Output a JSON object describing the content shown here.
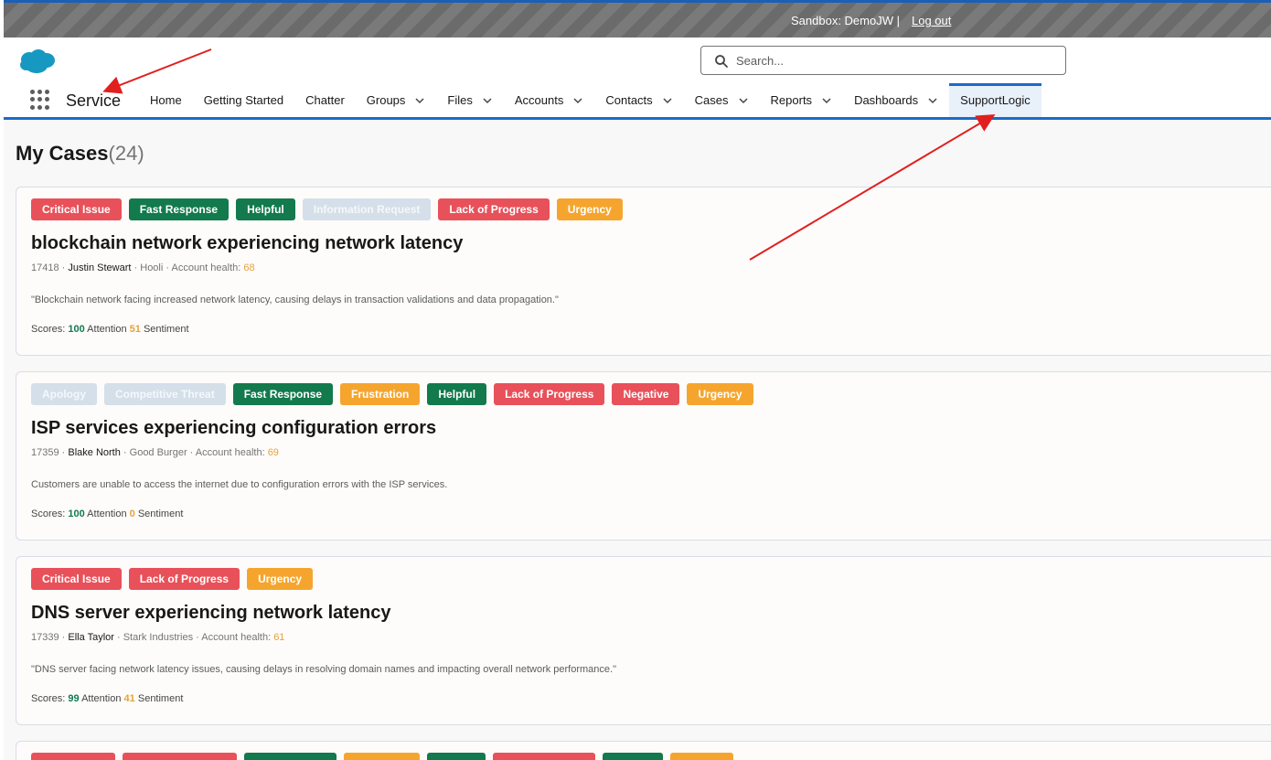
{
  "sandbox": {
    "label": "Sandbox: DemoJW |",
    "logout": "Log out"
  },
  "search": {
    "placeholder": "Search..."
  },
  "app": {
    "name": "Service"
  },
  "nav": [
    {
      "label": "Home"
    },
    {
      "label": "Getting Started"
    },
    {
      "label": "Chatter"
    },
    {
      "label": "Groups"
    },
    {
      "label": "Files"
    },
    {
      "label": "Accounts"
    },
    {
      "label": "Contacts"
    },
    {
      "label": "Cases"
    },
    {
      "label": "Reports"
    },
    {
      "label": "Dashboards"
    },
    {
      "label": "SupportLogic"
    }
  ],
  "page": {
    "title": "My Cases",
    "count": "(24)"
  },
  "colors": {
    "accent": "#1b6ac9",
    "red_tag": "#e8515a",
    "green_tag": "#127a4d",
    "orange_tag": "#f5a52e",
    "gray_tag": "#d4dfe9"
  },
  "cases": [
    {
      "tags": [
        {
          "label": "Critical Issue",
          "color": "red"
        },
        {
          "label": "Fast Response",
          "color": "green"
        },
        {
          "label": "Helpful",
          "color": "green"
        },
        {
          "label": "Information Request",
          "color": "gray"
        },
        {
          "label": "Lack of Progress",
          "color": "red"
        },
        {
          "label": "Urgency",
          "color": "orange"
        }
      ],
      "title": "blockchain network experiencing network latency",
      "number": "17418 ·",
      "contact": "Justin Stewart",
      "account": "· Hooli · Account health:",
      "health": "68",
      "description": "\"Blockchain network facing increased network latency, causing delays in transaction validations and data propagation.\"",
      "scores_label": "Scores:",
      "attention": "100",
      "attention_label": "Attention",
      "sentiment": "51",
      "sentiment_label": "Sentiment"
    },
    {
      "tags": [
        {
          "label": "Apology",
          "color": "gray"
        },
        {
          "label": "Competitive Threat",
          "color": "gray"
        },
        {
          "label": "Fast Response",
          "color": "green"
        },
        {
          "label": "Frustration",
          "color": "orange"
        },
        {
          "label": "Helpful",
          "color": "green"
        },
        {
          "label": "Lack of Progress",
          "color": "red"
        },
        {
          "label": "Negative",
          "color": "red"
        },
        {
          "label": "Urgency",
          "color": "orange"
        }
      ],
      "title": "ISP services experiencing configuration errors",
      "number": "17359 ·",
      "contact": "Blake North",
      "account": "· Good Burger · Account health:",
      "health": "69",
      "description": "Customers are unable to access the internet due to configuration errors with the ISP services.",
      "scores_label": "Scores:",
      "attention": "100",
      "attention_label": "Attention",
      "sentiment": "0",
      "sentiment_label": "Sentiment"
    },
    {
      "tags": [
        {
          "label": "Critical Issue",
          "color": "red"
        },
        {
          "label": "Lack of Progress",
          "color": "red"
        },
        {
          "label": "Urgency",
          "color": "orange"
        }
      ],
      "title": "DNS server experiencing network latency",
      "number": "17339 ·",
      "contact": "Ella Taylor",
      "account": "· Stark Industries · Account health:",
      "health": "61",
      "description": "\"DNS server facing network latency issues, causing delays in resolving domain names and impacting overall network performance.\"",
      "scores_label": "Scores:",
      "attention": "99",
      "attention_label": "Attention",
      "sentiment": "41",
      "sentiment_label": "Sentiment"
    }
  ],
  "partial_card_tag_colors": [
    "red",
    "red",
    "green",
    "orange",
    "green",
    "red",
    "green",
    "orange"
  ]
}
